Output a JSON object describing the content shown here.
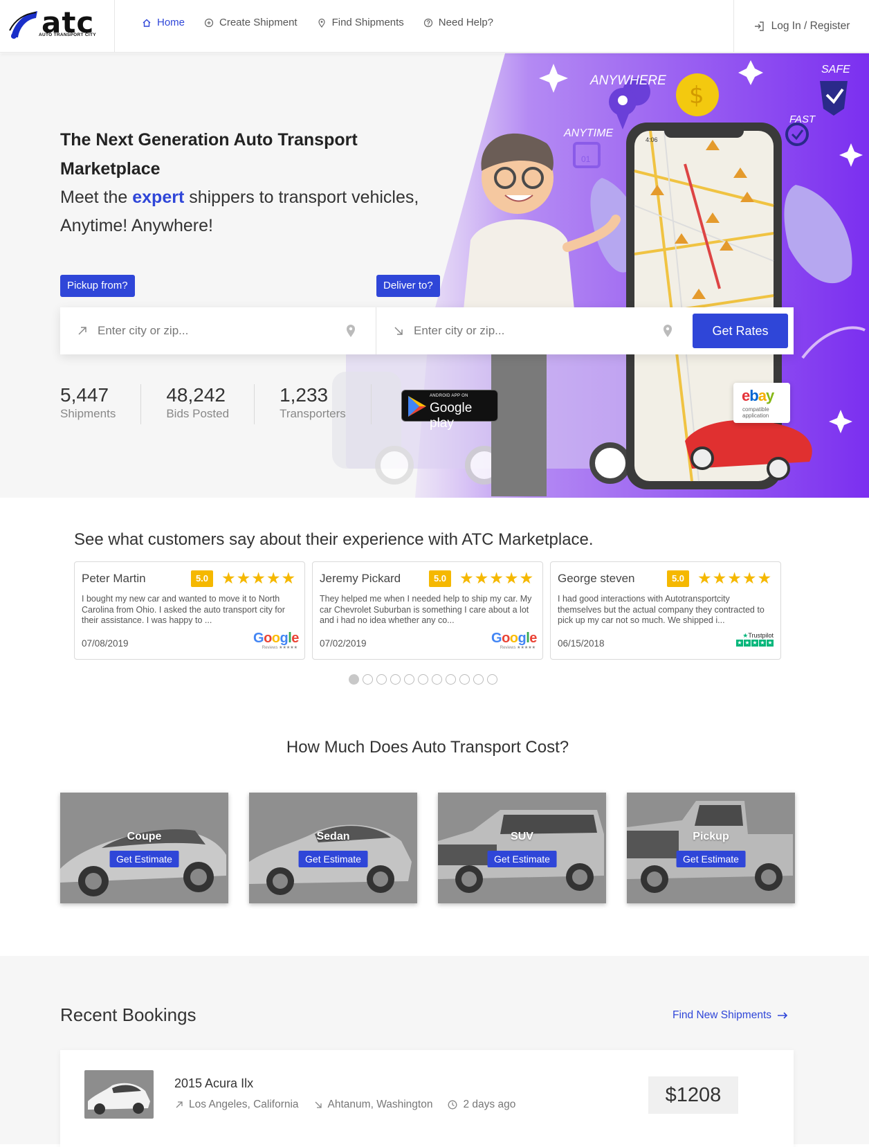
{
  "brand": {
    "name": "atc",
    "tagline": "AUTO TRANSPORT CITY"
  },
  "nav": {
    "items": [
      {
        "label": "Home",
        "icon": "home-icon",
        "active": true
      },
      {
        "label": "Create Shipment",
        "icon": "plus-circle-icon",
        "active": false
      },
      {
        "label": "Find Shipments",
        "icon": "map-pin-icon",
        "active": false
      },
      {
        "label": "Need Help?",
        "icon": "help-circle-icon",
        "active": false
      }
    ],
    "login_label": "Log In / Register"
  },
  "hero": {
    "title": "The Next Generation Auto Transport Marketplace",
    "subtitle_before": "Meet the ",
    "subtitle_accent": "expert",
    "subtitle_after": " shippers to transport vehicles, Anytime! Anywhere!",
    "pickup_tag": "Pickup from?",
    "deliver_tag": "Deliver to?",
    "pickup_placeholder": "Enter city or zip...",
    "deliver_placeholder": "Enter city or zip...",
    "get_rates_label": "Get Rates",
    "stats": [
      {
        "value": "5,447",
        "label": "Shipments"
      },
      {
        "value": "48,242",
        "label": "Bids Posted"
      },
      {
        "value": "1,233",
        "label": "Transporters"
      }
    ],
    "google_play": {
      "small": "ANDROID APP ON",
      "big": "Google play"
    },
    "illustration_words": {
      "anywhere": "ANYWHERE",
      "anytime": "ANYTIME",
      "fast": "FAST",
      "safe": "SAFE",
      "calendar_day": "01"
    },
    "phone_time": "4:06",
    "ebay": {
      "logo": "ebay",
      "caption_line1": "compatible",
      "caption_line2": "application"
    }
  },
  "reviews": {
    "title": "See what customers say about their experience with ATC Marketplace.",
    "items": [
      {
        "name": "Peter Martin",
        "score": "5.0",
        "stars": "★★★★★",
        "text": "I bought my new car and wanted to move it to North Carolina from Ohio. I asked the auto transport city for their assistance. I was happy to ...",
        "date": "07/08/2019",
        "source": "Google",
        "source_sub": "Reviews ★★★★★"
      },
      {
        "name": "Jeremy Pickard",
        "score": "5.0",
        "stars": "★★★★★",
        "text": "They helped me when I needed help to ship my car. My car Chevrolet Suburban is something I care about a lot and i had no idea whether any co...",
        "date": "07/02/2019",
        "source": "Google",
        "source_sub": "Reviews ★★★★★"
      },
      {
        "name": "George steven",
        "score": "5.0",
        "stars": "★★★★★",
        "text": "I had good interactions with Autotransportcity themselves but the actual company they contracted to pick up my car not so much. We shipped i...",
        "date": "06/15/2018",
        "source": "Trustpilot",
        "source_sub": "★★★★★"
      }
    ],
    "page_count": 11,
    "active_page": 1
  },
  "cost": {
    "title": "How Much Does Auto Transport Cost?",
    "cards": [
      {
        "label": "Coupe",
        "button": "Get Estimate"
      },
      {
        "label": "Sedan",
        "button": "Get Estimate"
      },
      {
        "label": "SUV",
        "button": "Get Estimate"
      },
      {
        "label": "Pickup",
        "button": "Get Estimate"
      }
    ]
  },
  "recent": {
    "title": "Recent Bookings",
    "link_label": "Find New Shipments",
    "booking": {
      "vehicle": "2015 Acura Ilx",
      "from": "Los Angeles, California",
      "to": "Ahtanum, Washington",
      "posted": "2 days ago",
      "price": "$1208"
    }
  },
  "colors": {
    "accent": "#2f46d8",
    "star": "#f5b800",
    "purple": "#7b2ff0"
  }
}
